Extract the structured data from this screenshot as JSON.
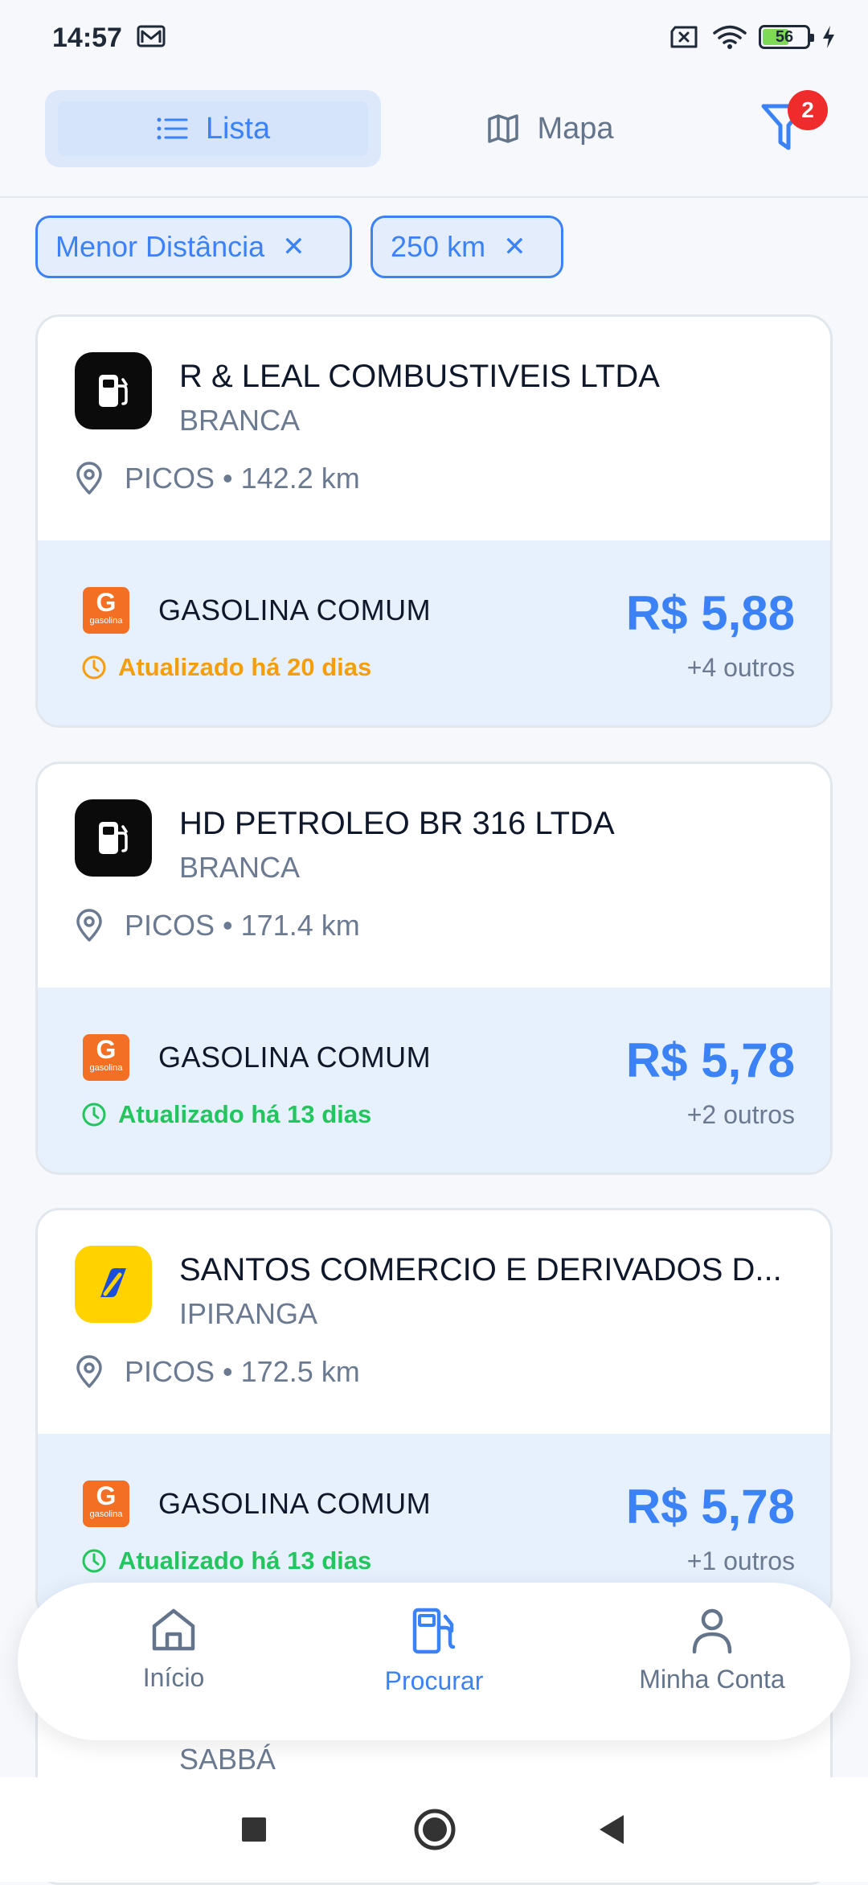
{
  "status_bar": {
    "time": "14:57",
    "battery": "56",
    "battery_level": 0.56
  },
  "view_switch": {
    "list_label": "Lista",
    "map_label": "Mapa",
    "active": "list",
    "filter_count": "2"
  },
  "chips": [
    {
      "label": "Menor Distância"
    },
    {
      "label": "250 km"
    }
  ],
  "stations": [
    {
      "name": "R & LEAL COMBUSTIVEIS LTDA",
      "brand": "BRANCA",
      "location": "PICOS • 142.2 km",
      "fuel": "GASOLINA COMUM",
      "fuel_icon_letter": "G",
      "fuel_icon_text": "gasolina",
      "updated": "Atualizado há 20 dias",
      "updated_color": "#f59e0b",
      "price": "R$ 5,88",
      "others": "+4 outros"
    },
    {
      "name": "HD PETROLEO BR 316 LTDA",
      "brand": "BRANCA",
      "location": "PICOS • 171.4 km",
      "fuel": "GASOLINA COMUM",
      "fuel_icon_letter": "G",
      "fuel_icon_text": "gasolina",
      "updated": "Atualizado há 13 dias",
      "updated_color": "#22c55e",
      "price": "R$ 5,78",
      "others": "+2 outros"
    },
    {
      "name": "SANTOS COMERCIO E DERIVADOS D...",
      "brand": "IPIRANGA",
      "location": "PICOS • 172.5 km",
      "fuel": "GASOLINA COMUM",
      "fuel_icon_letter": "G",
      "fuel_icon_text": "gasolina",
      "updated": "Atualizado há 13 dias",
      "updated_color": "#22c55e",
      "price": "R$ 5,78",
      "others": "+1 outros"
    },
    {
      "brand": "SABBÁ"
    }
  ],
  "bottom_nav": {
    "home": "Início",
    "search": "Procurar",
    "account": "Minha Conta",
    "active": "search"
  },
  "colors": {
    "accent": "#3b82f6",
    "badge": "#ef2b2b",
    "fuel_icon": "#f26f24",
    "price_panel": "#e7f0fd"
  }
}
